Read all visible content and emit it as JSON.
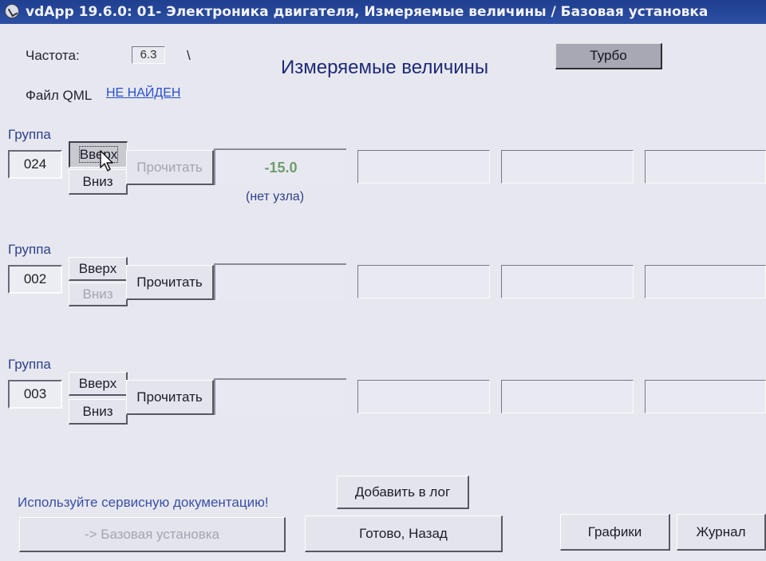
{
  "window": {
    "title": "vdApp 19.6.0: 01- Электроника двигателя,  Измеряемые величины / Базовая установка"
  },
  "header": {
    "freq_label": "Частота:",
    "freq_value": "6.3",
    "freq_sep": "\\",
    "page_title": "Измеряемые величины",
    "turbo_label": "Турбо",
    "qml_label": "Файл QML",
    "qml_status": "НЕ НАЙДЕН"
  },
  "groups": [
    {
      "label": "Группа",
      "number": "024",
      "up_label": "Вверх",
      "down_label": "Вниз",
      "read_label": "Прочитать",
      "values": [
        "-15.0",
        "",
        "",
        ""
      ],
      "note": "(нет узла)"
    },
    {
      "label": "Группа",
      "number": "002",
      "up_label": "Вверх",
      "down_label": "Вниз",
      "read_label": "Прочитать",
      "values": [
        "",
        "",
        "",
        ""
      ]
    },
    {
      "label": "Группа",
      "number": "003",
      "up_label": "Вверх",
      "down_label": "Вниз",
      "read_label": "Прочитать",
      "values": [
        "",
        "",
        "",
        ""
      ]
    }
  ],
  "footer": {
    "hint": "Используйте сервисную документацию!",
    "add_log_label": "Добавить в лог",
    "basic_setting_label": "-> Базовая установка",
    "done_back_label": "Готово, Назад",
    "graphs_label": "Графики",
    "journal_label": "Журнал"
  },
  "colors": {
    "titlebar": "#2c4fa4",
    "background": "#e7e8ef",
    "link": "#2a4fd0",
    "value_green": "#6f9c6f",
    "group_label": "#2c3f8c"
  }
}
